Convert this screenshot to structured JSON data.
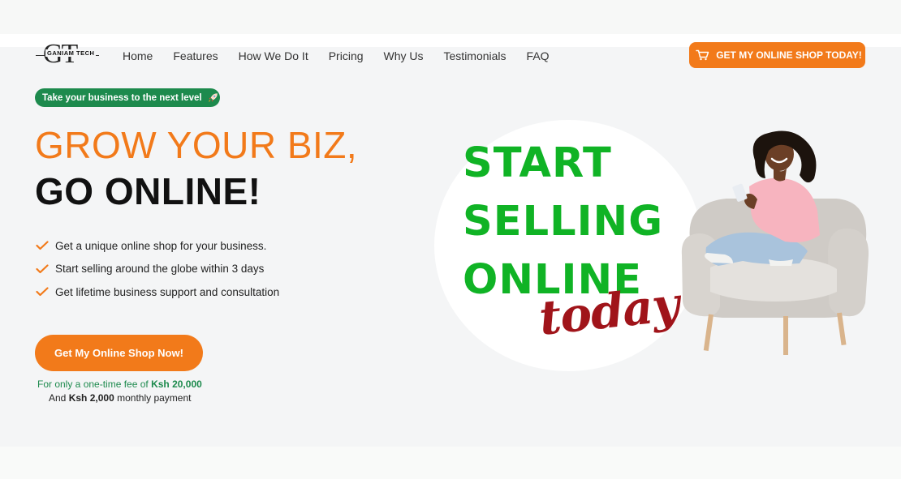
{
  "header": {
    "logo_monogram": "GT",
    "logo_brand": "GANIAM TECH",
    "nav": [
      "Home",
      "Features",
      "How We Do It",
      "Pricing",
      "Why Us",
      "Testimonials",
      "FAQ"
    ],
    "cta_label": "GET MY ONLINE SHOP TODAY!"
  },
  "hero": {
    "badge": "Take your business to the next level",
    "badge_icon": "rocket-icon",
    "headline_line1": "GROW YOUR BIZ,",
    "headline_line2": "GO ONLINE!",
    "features": [
      "Get a unique online shop for your business.",
      "Start selling around the globe within 3 days",
      "Get lifetime business support and consultation"
    ],
    "cta_label": "Get My Online Shop Now!",
    "fee_prefix": "For only a one-time fee of",
    "fee_amount": "Ksh 20,000",
    "monthly_prefix": "And",
    "monthly_amount": "Ksh 2,000",
    "monthly_suffix": "monthly payment"
  },
  "promo": {
    "line1": "START",
    "line2": "SELLING",
    "line3": "ONLINE",
    "script": "today"
  },
  "colors": {
    "accent_orange": "#f27a1a",
    "brand_green": "#1d8a4d",
    "promo_green": "#10b325",
    "script_red": "#a0141a"
  }
}
